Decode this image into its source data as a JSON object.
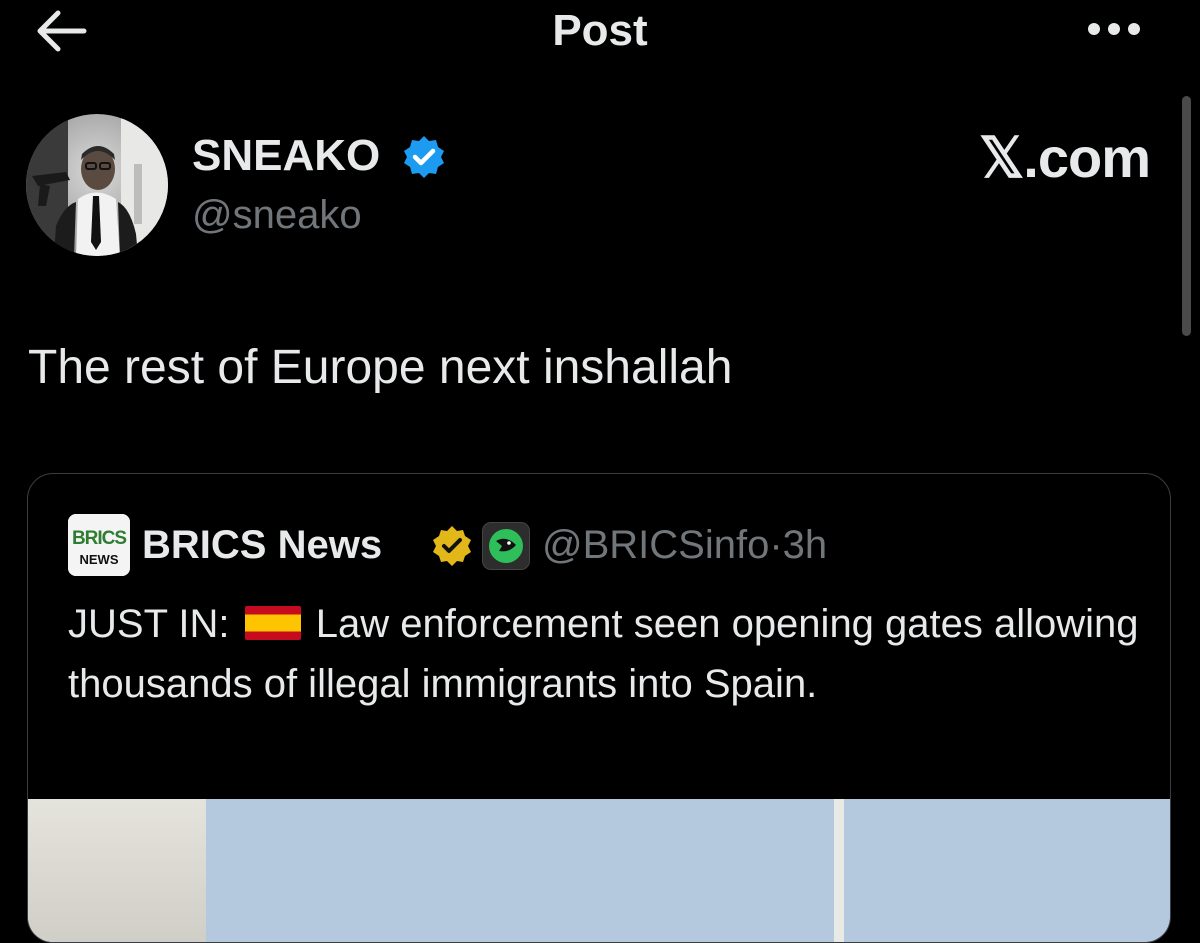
{
  "header": {
    "title": "Post",
    "back_icon": "arrow-left-icon",
    "more_icon": "more-horizontal-icon"
  },
  "post": {
    "author_name": "SNEAKO",
    "author_handle": "@sneako",
    "verified_badge": "verified-blue-icon",
    "watermark": "𝕏.com",
    "text": "The rest of Europe next inshallah"
  },
  "quote": {
    "avatar_text_top": "BRICS",
    "avatar_text_bottom": "NEWS",
    "author_name": "BRICS News",
    "gold_badge": "verified-gold-icon",
    "affiliate_badge": "affiliate-icon",
    "handle": "@BRICSinfo",
    "separator": "·",
    "time": "3h",
    "text_prefix": "JUST IN:",
    "flag": "flag-spain-icon",
    "text_body": "Law enforcement seen opening gates allowing thousands of illegal immigrants into Spain."
  },
  "colors": {
    "background": "#000000",
    "primary_text": "#e7e9ea",
    "secondary_text": "#71767b",
    "verified_blue": "#1d9bf0",
    "verified_gold": "#e2b719",
    "border": "#3a3e42"
  }
}
